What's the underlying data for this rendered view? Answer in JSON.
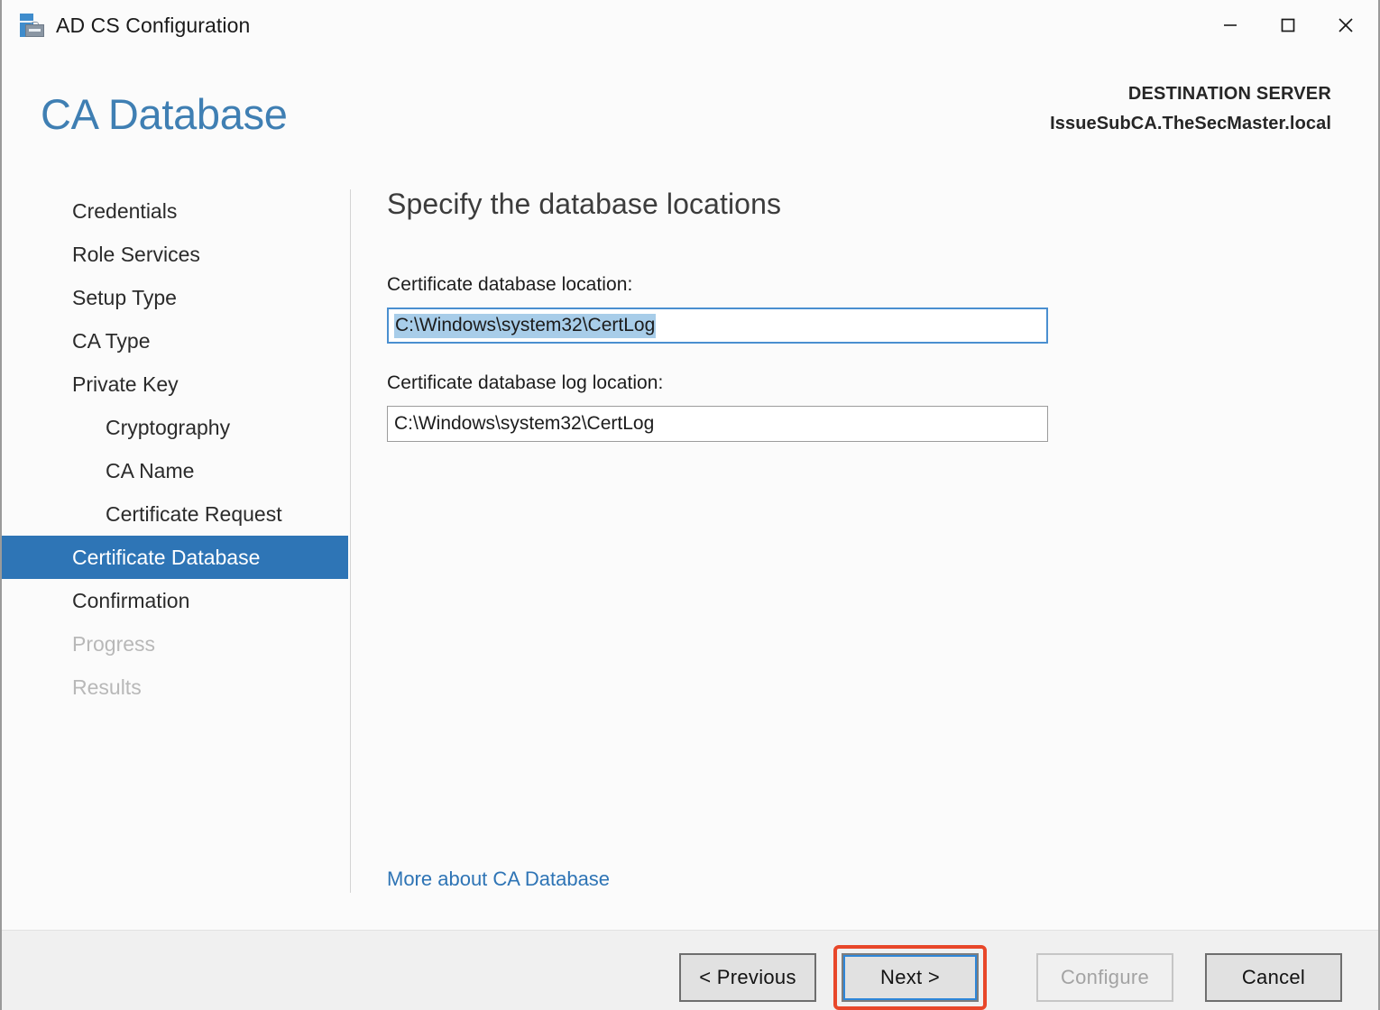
{
  "window": {
    "title": "AD CS Configuration",
    "icon": "adcs-server-toolbox-icon",
    "controls": {
      "minimize": "minimize-icon",
      "maximize": "maximize-icon",
      "close": "close-icon"
    }
  },
  "header": {
    "page_title": "CA Database",
    "destination_label": "DESTINATION SERVER",
    "destination_server": "IssueSubCA.TheSecMaster.local"
  },
  "sidebar": {
    "items": [
      {
        "label": "Credentials",
        "state": "normal",
        "indent": false
      },
      {
        "label": "Role Services",
        "state": "normal",
        "indent": false
      },
      {
        "label": "Setup Type",
        "state": "normal",
        "indent": false
      },
      {
        "label": "CA Type",
        "state": "normal",
        "indent": false
      },
      {
        "label": "Private Key",
        "state": "normal",
        "indent": false
      },
      {
        "label": "Cryptography",
        "state": "normal",
        "indent": true
      },
      {
        "label": "CA Name",
        "state": "normal",
        "indent": true
      },
      {
        "label": "Certificate Request",
        "state": "normal",
        "indent": true
      },
      {
        "label": "Certificate Database",
        "state": "selected",
        "indent": false
      },
      {
        "label": "Confirmation",
        "state": "normal",
        "indent": false
      },
      {
        "label": "Progress",
        "state": "disabled",
        "indent": false
      },
      {
        "label": "Results",
        "state": "disabled",
        "indent": false
      }
    ]
  },
  "main": {
    "heading": "Specify the database locations",
    "fields": [
      {
        "label": "Certificate database location:",
        "value": "C:\\Windows\\system32\\CertLog",
        "focused": true,
        "selected": true
      },
      {
        "label": "Certificate database log location:",
        "value": "C:\\Windows\\system32\\CertLog",
        "focused": false,
        "selected": false
      }
    ],
    "more_link": "More about CA Database"
  },
  "footer": {
    "previous_label": "< Previous",
    "next_label": "Next >",
    "configure_label": "Configure",
    "cancel_label": "Cancel"
  },
  "colors": {
    "accent_blue": "#2e75b6",
    "title_blue": "#3f7fb3",
    "link_blue": "#2e74b5",
    "annotation_red": "#e8472a",
    "selection_blue": "#a8cde9",
    "footer_bg": "#f0f0f0"
  }
}
